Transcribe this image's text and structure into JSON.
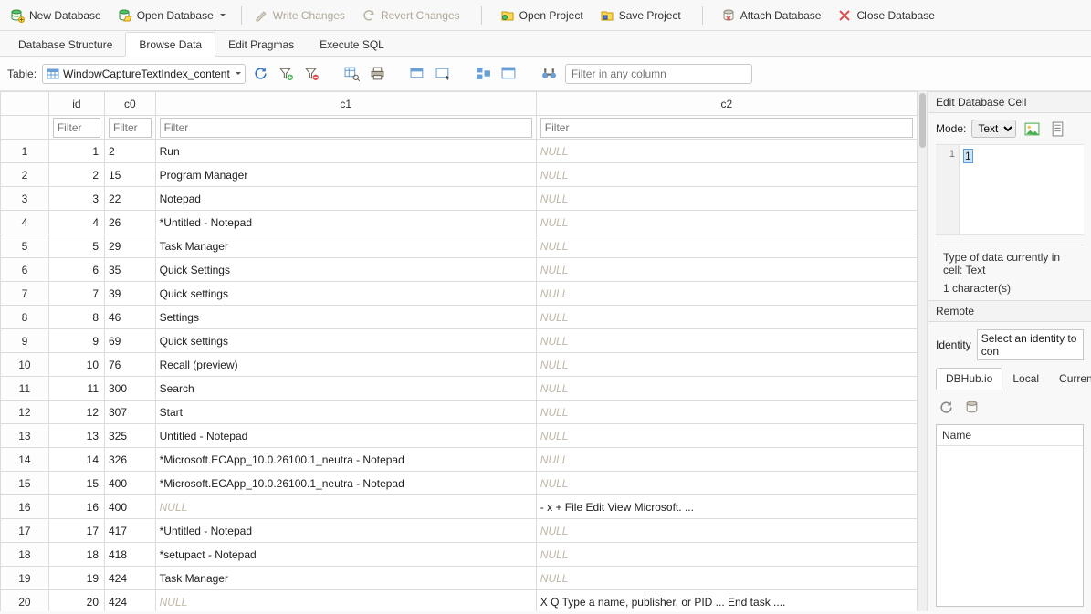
{
  "toolbar": {
    "new_db": "New Database",
    "open_db": "Open Database",
    "write_changes": "Write Changes",
    "revert_changes": "Revert Changes",
    "open_project": "Open Project",
    "save_project": "Save Project",
    "attach_db": "Attach Database",
    "close_db": "Close Database"
  },
  "tabs": {
    "database_structure": "Database Structure",
    "browse_data": "Browse Data",
    "edit_pragmas": "Edit Pragmas",
    "execute_sql": "Execute SQL"
  },
  "browse": {
    "table_label": "Table:",
    "table_name": "WindowCaptureTextIndex_content",
    "filter_placeholder": "Filter in any column"
  },
  "grid": {
    "headers": {
      "id": "id",
      "c0": "c0",
      "c1": "c1",
      "c2": "c2"
    },
    "filter_placeholder": "Filter",
    "rows": [
      {
        "n": "1",
        "id": "1",
        "c0": "2",
        "c1": "Run",
        "c2": null
      },
      {
        "n": "2",
        "id": "2",
        "c0": "15",
        "c1": "Program Manager",
        "c2": null
      },
      {
        "n": "3",
        "id": "3",
        "c0": "22",
        "c1": "Notepad",
        "c2": null
      },
      {
        "n": "4",
        "id": "4",
        "c0": "26",
        "c1": "*Untitled - Notepad",
        "c2": null
      },
      {
        "n": "5",
        "id": "5",
        "c0": "29",
        "c1": "Task Manager",
        "c2": null
      },
      {
        "n": "6",
        "id": "6",
        "c0": "35",
        "c1": "Quick Settings",
        "c2": null
      },
      {
        "n": "7",
        "id": "7",
        "c0": "39",
        "c1": "Quick settings",
        "c2": null
      },
      {
        "n": "8",
        "id": "8",
        "c0": "46",
        "c1": "Settings",
        "c2": null
      },
      {
        "n": "9",
        "id": "9",
        "c0": "69",
        "c1": "Quick settings",
        "c2": null
      },
      {
        "n": "10",
        "id": "10",
        "c0": "76",
        "c1": "Recall (preview)",
        "c2": null
      },
      {
        "n": "11",
        "id": "11",
        "c0": "300",
        "c1": "Search",
        "c2": null
      },
      {
        "n": "12",
        "id": "12",
        "c0": "307",
        "c1": "Start",
        "c2": null
      },
      {
        "n": "13",
        "id": "13",
        "c0": "325",
        "c1": "Untitled - Notepad",
        "c2": null
      },
      {
        "n": "14",
        "id": "14",
        "c0": "326",
        "c1": "*Microsoft.ECApp_10.0.26100.1_neutra - Notepad",
        "c2": null
      },
      {
        "n": "15",
        "id": "15",
        "c0": "400",
        "c1": "*Microsoft.ECApp_10.0.26100.1_neutra - Notepad",
        "c2": null
      },
      {
        "n": "16",
        "id": "16",
        "c0": "400",
        "c1": null,
        "c2": "- x + File Edit View Microsoft. ..."
      },
      {
        "n": "17",
        "id": "17",
        "c0": "417",
        "c1": "*Untitled - Notepad",
        "c2": null
      },
      {
        "n": "18",
        "id": "18",
        "c0": "418",
        "c1": "*setupact - Notepad",
        "c2": null
      },
      {
        "n": "19",
        "id": "19",
        "c0": "424",
        "c1": "Task Manager",
        "c2": null
      },
      {
        "n": "20",
        "id": "20",
        "c0": "424",
        "c1": null,
        "c2": "X Q Type a name, publisher, or PID ... End task ...."
      }
    ],
    "null_text": "NULL"
  },
  "cell_editor": {
    "title": "Edit Database Cell",
    "mode_label": "Mode:",
    "mode_value": "Text",
    "line_number": "1",
    "cell_value": "1",
    "type_info": "Type of data currently in cell: Text",
    "size_info": "1 character(s)"
  },
  "remote": {
    "title": "Remote",
    "identity_label": "Identity",
    "identity_placeholder": "Select an identity to con",
    "tabs": {
      "dbhub": "DBHub.io",
      "local": "Local",
      "current": "Curren"
    },
    "list_header": "Name"
  }
}
